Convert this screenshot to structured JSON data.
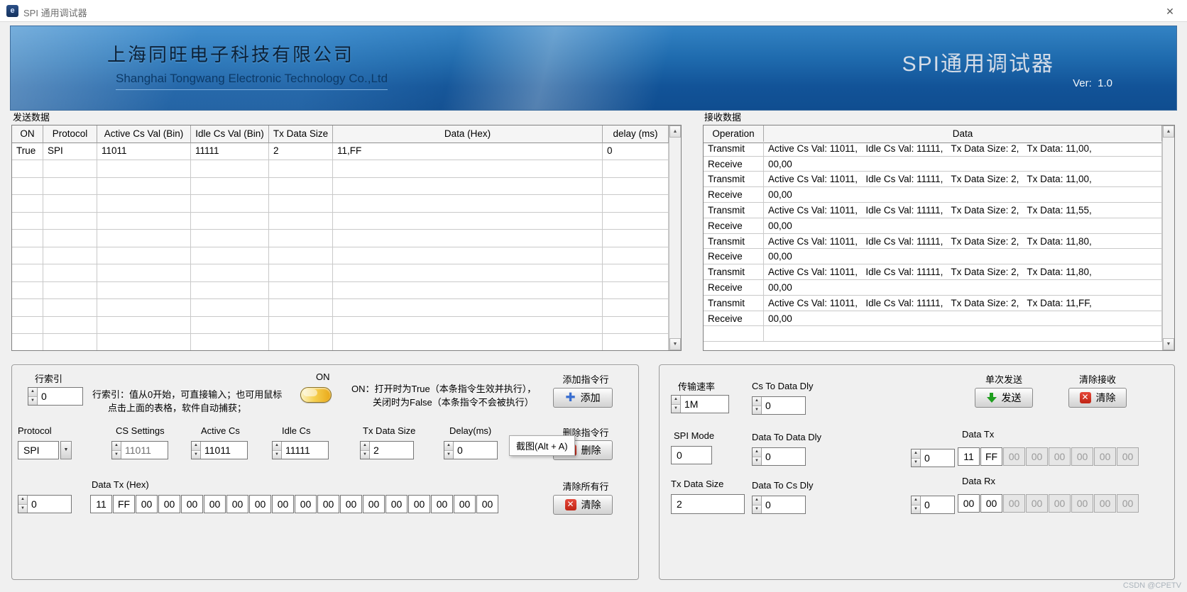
{
  "window": {
    "title": "SPI 通用调试器",
    "close_glyph": "✕",
    "icon_glyph": "e"
  },
  "banner": {
    "company_cn": "上海同旺电子科技有限公司",
    "company_en": "Shanghai Tongwang Electronic Technology Co.,Ltd",
    "app_title": "SPI通用调试器",
    "version": "Ver:  1.0"
  },
  "send": {
    "section_label": "发送数据",
    "columns": [
      "ON",
      "Protocol",
      "Active Cs Val (Bin)",
      "Idle Cs Val (Bin)",
      "Tx Data Size",
      "Data (Hex)",
      "delay (ms)"
    ],
    "rows": [
      [
        "True",
        "SPI",
        "11011",
        "11111",
        "2",
        "11,FF",
        "0"
      ]
    ],
    "empty_rows": 11
  },
  "receive": {
    "section_label": "接收数据",
    "columns": [
      "Operation",
      "Data"
    ],
    "rows": [
      [
        "Transmit",
        "Active Cs Val: 11011,   Idle Cs Val: 11111,   Tx Data Size: 2,   Tx Data: 11,00,"
      ],
      [
        "Receive",
        "00,00"
      ],
      [
        "Transmit",
        "Active Cs Val: 11011,   Idle Cs Val: 11111,   Tx Data Size: 2,   Tx Data: 11,00,"
      ],
      [
        "Receive",
        "00,00"
      ],
      [
        "Transmit",
        "Active Cs Val: 11011,   Idle Cs Val: 11111,   Tx Data Size: 2,   Tx Data: 11,55,"
      ],
      [
        "Receive",
        "00,00"
      ],
      [
        "Transmit",
        "Active Cs Val: 11011,   Idle Cs Val: 11111,   Tx Data Size: 2,   Tx Data: 11,80,"
      ],
      [
        "Receive",
        "00,00"
      ],
      [
        "Transmit",
        "Active Cs Val: 11011,   Idle Cs Val: 11111,   Tx Data Size: 2,   Tx Data: 11,80,"
      ],
      [
        "Receive",
        "00,00"
      ],
      [
        "Transmit",
        "Active Cs Val: 11011,   Idle Cs Val: 11111,   Tx Data Size: 2,   Tx Data: 11,FF,"
      ],
      [
        "Receive",
        "00,00"
      ]
    ],
    "empty_rows": 1
  },
  "left_panel": {
    "row_index": {
      "label": "行索引",
      "value": "0"
    },
    "hint1a": "行索引：值从0开始，可直接输入；也可用鼠标",
    "hint1b": "点击上面的表格，软件自动捕获；",
    "on_label": "ON",
    "on_hint1": "ON：打开时为True（本条指令生效并执行），",
    "on_hint2": "关闭时为False（本条指令不会被执行）",
    "add": {
      "label": "添加指令行",
      "button": "添加"
    },
    "protocol": {
      "label": "Protocol",
      "value": "SPI"
    },
    "cs_settings": {
      "label": "CS Settings",
      "value": "11011"
    },
    "active_cs": {
      "label": "Active Cs",
      "value": "11011"
    },
    "idle_cs": {
      "label": "Idle Cs",
      "value": "11111"
    },
    "tx_data_size": {
      "label": "Tx Data Size",
      "value": "2"
    },
    "delay": {
      "label": "Delay(ms)",
      "value": "0"
    },
    "del": {
      "label": "删除指令行",
      "button": "删除"
    },
    "tooltip": "截图(Alt + A)",
    "data_tx": {
      "label": "Data Tx (Hex)",
      "index_value": "0",
      "bytes": [
        "11",
        "FF",
        "00",
        "00",
        "00",
        "00",
        "00",
        "00",
        "00",
        "00",
        "00",
        "00",
        "00",
        "00",
        "00",
        "00",
        "00",
        "00"
      ]
    },
    "clear_all": {
      "label": "清除所有行",
      "button": "清除"
    }
  },
  "right_panel": {
    "rate": {
      "label": "传输速率",
      "value": "1M"
    },
    "cs_to_data": {
      "label": "Cs To Data Dly",
      "value": "0"
    },
    "send": {
      "label": "单次发送",
      "button": "发送"
    },
    "clear_rx": {
      "label": "清除接收",
      "button": "清除"
    },
    "spi_mode": {
      "label": "SPI Mode",
      "value": "0"
    },
    "data_to_data": {
      "label": "Data To Data Dly",
      "value": "0"
    },
    "data_tx": {
      "label": "Data Tx",
      "index_value": "0",
      "bytes": [
        "11",
        "FF",
        "00",
        "00",
        "00",
        "00",
        "00",
        "00"
      ],
      "active_count": 2
    },
    "tx_size": {
      "label": "Tx Data Size",
      "value": "2"
    },
    "data_to_cs": {
      "label": "Data To Cs Dly",
      "value": "0"
    },
    "data_rx": {
      "label": "Data Rx",
      "index_value": "0",
      "bytes": [
        "00",
        "00",
        "00",
        "00",
        "00",
        "00",
        "00",
        "00"
      ],
      "active_count": 2
    }
  },
  "watermark": "CSDN @CPETV"
}
